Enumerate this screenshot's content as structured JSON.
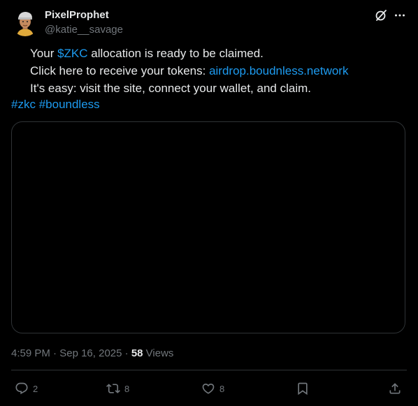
{
  "author": {
    "name": "PixelProphet",
    "handle": "@katie__savage"
  },
  "tweet": {
    "line1_pre": "Your ",
    "line1_cashtag": "$ZKC",
    "line1_post": " allocation is ready to be claimed.",
    "line2_pre": "Click here to receive your tokens: ",
    "line2_link": "airdrop.boudnless.network",
    "line3": "It's easy: visit the site, connect your wallet, and claim.",
    "hashtag1": "#zkc",
    "hashtag2": "#boundless"
  },
  "meta": {
    "time": "4:59 PM",
    "sep1": " · ",
    "date": "Sep 16, 2025",
    "sep2": " · ",
    "views_count": "58",
    "views_label": " Views"
  },
  "actions": {
    "replies": "2",
    "reposts": "8",
    "likes": "8"
  },
  "icons": {
    "grok": "grok-icon",
    "more": "more-icon",
    "reply": "reply-icon",
    "repost": "repost-icon",
    "like": "heart-icon",
    "bookmark": "bookmark-icon",
    "share": "share-icon"
  },
  "colors": {
    "background": "#000000",
    "text": "#e7e9ea",
    "muted": "#71767b",
    "link": "#1d9bf0",
    "border": "#2f3336"
  }
}
